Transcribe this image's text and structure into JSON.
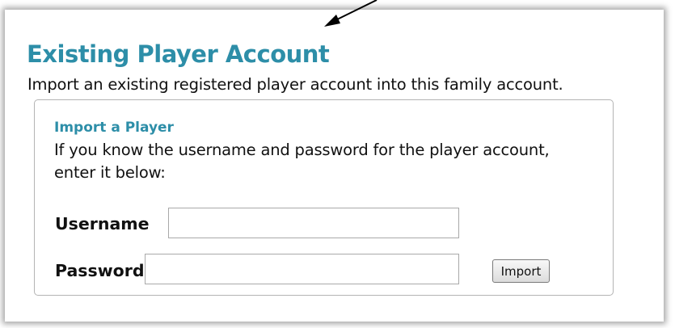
{
  "page": {
    "title": "Existing Player Account",
    "description": "Import an existing registered player account into this family account."
  },
  "import_panel": {
    "title": "Import a Player",
    "description": "If you know the username and password for the player account, enter it below:",
    "username_label": "Username",
    "username_value": "",
    "password_label": "Password",
    "password_value": "",
    "import_button_label": "Import"
  },
  "icons": {
    "annotation_arrow": "arrow-icon"
  }
}
